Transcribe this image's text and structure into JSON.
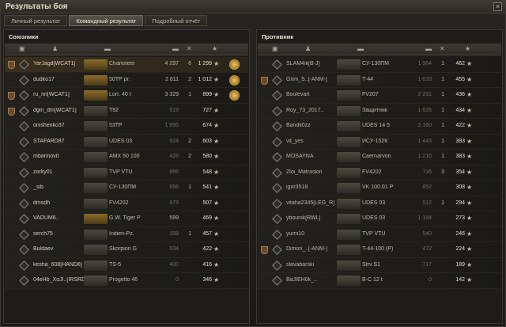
{
  "window": {
    "title": "Результаты боя",
    "close": "×"
  },
  "tabs": [
    "Личный результат",
    "Командный результат",
    "Подробный отчёт"
  ],
  "active_tab": 1,
  "allies": {
    "title": "Союзники",
    "rows": [
      {
        "nick": "YarJagd[WCAT1]",
        "tank": "Charioteer",
        "damage": "4 297",
        "kills": "6",
        "xp": "1 299",
        "medal": true,
        "highlight": true,
        "clan": true,
        "gold": true
      },
      {
        "nick": "dudko17",
        "tank": "50TP pr.",
        "damage": "2 611",
        "kills": "2",
        "xp": "1 012",
        "medal": true,
        "gold": true
      },
      {
        "nick": "ru_nn[WCAT1]",
        "tank": "Lorr. 40 t",
        "damage": "3 329",
        "kills": "1",
        "xp": "899",
        "medal": true,
        "clan": true,
        "gold": true
      },
      {
        "nick": "dgin_dm[WCAT1]",
        "tank": "T92",
        "damage": "619",
        "kills": "",
        "xp": "727",
        "clan": true,
        "dim": true
      },
      {
        "nick": "onishenko37",
        "tank": "53TP",
        "damage": "1 695",
        "kills": "",
        "xp": "674",
        "dim": true
      },
      {
        "nick": "STAFARD87",
        "tank": "UDES 03",
        "damage": "824",
        "kills": "2",
        "xp": "603",
        "dim": true
      },
      {
        "nick": "mbarinov0",
        "tank": "AMX 50 100",
        "damage": "426",
        "kills": "2",
        "xp": "580",
        "dim": true
      },
      {
        "nick": "zorky01",
        "tank": "TVP VTU",
        "damage": "996",
        "kills": "",
        "xp": "548",
        "dim": true
      },
      {
        "nick": "_sib",
        "tank": "СУ-130ПМ",
        "damage": "666",
        "kills": "1",
        "xp": "541",
        "dim": true
      },
      {
        "nick": "dmsdh",
        "tank": "FV4202",
        "damage": "679",
        "kills": "",
        "xp": "507",
        "dim": true
      },
      {
        "nick": "VADUM6..",
        "tank": "G.W. Tiger P",
        "damage": "599",
        "kills": "",
        "xp": "469",
        "gold": true
      },
      {
        "nick": "serch75",
        "tank": "Indien-Pz.",
        "damage": "288",
        "kills": "1",
        "xp": "457",
        "dim": true
      },
      {
        "nick": "Buldaev",
        "tank": "Skorpion G",
        "damage": "534",
        "kills": "",
        "xp": "422",
        "dim": true
      },
      {
        "nick": "kesha_608[HAND8]",
        "tank": "TS-5",
        "damage": "400",
        "kills": "",
        "xp": "416",
        "dim": true
      },
      {
        "nick": "04eHb_XoJI..[IRSRD]",
        "tank": "Progetto 46",
        "damage": "0",
        "kills": "",
        "xp": "346",
        "dim": true
      }
    ]
  },
  "enemies": {
    "title": "Противник",
    "rows": [
      {
        "nick": "SLAM4ik[B-J]",
        "tank": "СУ-130ПМ",
        "damage": "1 964",
        "kills": "1",
        "xp": "462",
        "dim": true
      },
      {
        "nick": "Grim_S..[-ANM-]",
        "tank": "T-44",
        "damage": "1 633",
        "kills": "1",
        "xp": "455",
        "clan": true,
        "dim": true
      },
      {
        "nick": "Boulevart",
        "tank": "FV207",
        "damage": "2 231",
        "kills": "1",
        "xp": "436",
        "dim": true
      },
      {
        "nick": "Roy_73_2017..",
        "tank": "Защитник",
        "damage": "1 635",
        "kills": "1",
        "xp": "434",
        "dim": true
      },
      {
        "nick": "Bandit0zz",
        "tank": "UDES 14 5",
        "damage": "2 160",
        "kills": "1",
        "xp": "422",
        "dim": true
      },
      {
        "nick": "vit_yes",
        "tank": "ИСУ-152К",
        "damage": "1 443",
        "kills": "1",
        "xp": "383",
        "dim": true
      },
      {
        "nick": "MOSAYNA",
        "tank": "Caernarvon",
        "damage": "1 210",
        "kills": "1",
        "xp": "383",
        "dim": true
      },
      {
        "nick": "Zloi_Matraskin",
        "tank": "FV4202",
        "damage": "736",
        "kills": "3",
        "xp": "354",
        "dim": true
      },
      {
        "nick": "igor3518",
        "tank": "VK 100.01 P",
        "damage": "852",
        "kills": "",
        "xp": "308",
        "dim": true
      },
      {
        "nick": "vitaha2345[LEG_R]",
        "tank": "UDES 03",
        "damage": "512",
        "kills": "1",
        "xp": "294",
        "dim": true
      },
      {
        "nick": "ybounik[RWL]",
        "tank": "UDES 03",
        "damage": "1 184",
        "kills": "",
        "xp": "273",
        "dim": true
      },
      {
        "nick": "yurni10",
        "tank": "TVP VTU",
        "damage": "540",
        "kills": "",
        "xp": "246",
        "dim": true
      },
      {
        "nick": "Dimon_..[-ANM-]",
        "tank": "T-44-100 (P)",
        "damage": "472",
        "kills": "",
        "xp": "224",
        "clan": true,
        "dim": true
      },
      {
        "nick": "slavabarski",
        "tank": "Strv S1",
        "damage": "717",
        "kills": "",
        "xp": "189",
        "dim": true
      },
      {
        "nick": "BaJIEH0k_..",
        "tank": "B-C 12 t",
        "damage": "0",
        "kills": "",
        "xp": "142",
        "dim": true
      }
    ]
  },
  "icons": {
    "star": "★",
    "player": "♟",
    "tank": "▬",
    "frag": "✕"
  }
}
